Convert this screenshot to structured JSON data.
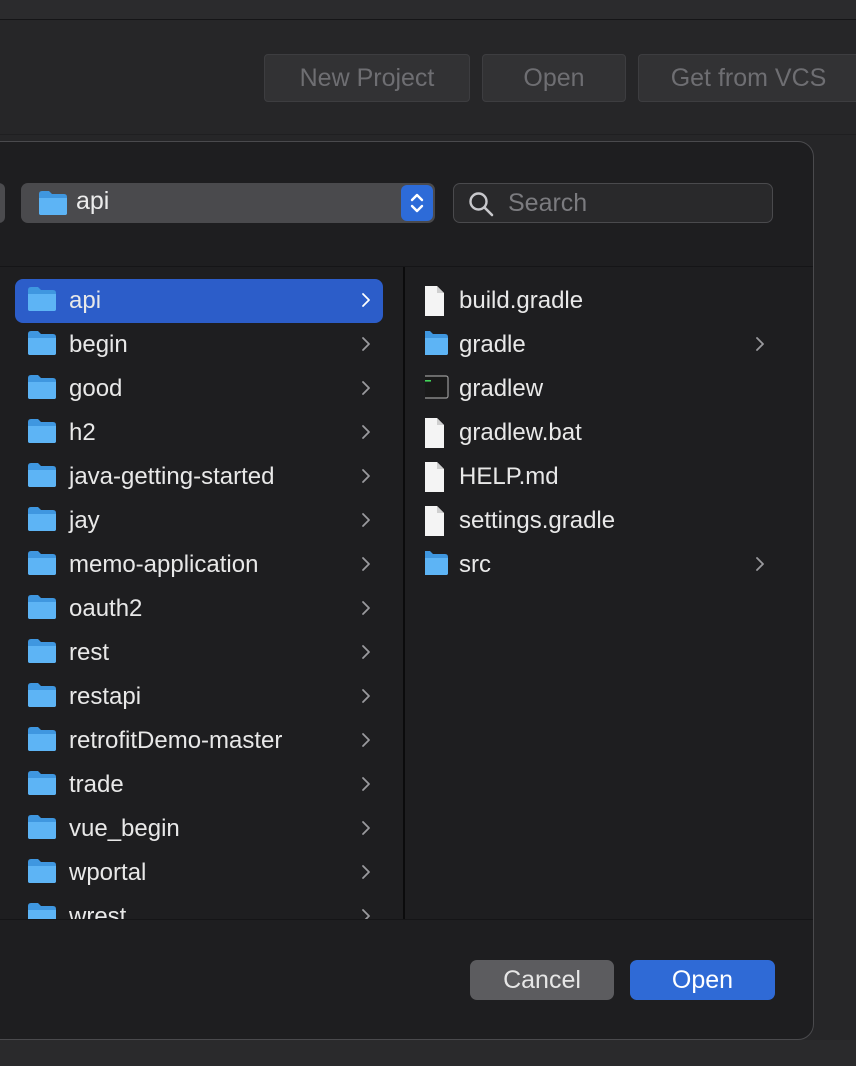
{
  "welcome": {
    "buttons": [
      "New Project",
      "Open",
      "Get from VCS"
    ]
  },
  "dialog": {
    "path_label": "api",
    "search_placeholder": "Search",
    "left_column": [
      {
        "label": "api",
        "kind": "folder",
        "selected": true
      },
      {
        "label": "begin",
        "kind": "folder"
      },
      {
        "label": "good",
        "kind": "folder"
      },
      {
        "label": "h2",
        "kind": "folder"
      },
      {
        "label": "java-getting-started",
        "kind": "folder"
      },
      {
        "label": "jay",
        "kind": "folder"
      },
      {
        "label": "memo-application",
        "kind": "folder"
      },
      {
        "label": "oauth2",
        "kind": "folder"
      },
      {
        "label": "rest",
        "kind": "folder"
      },
      {
        "label": "restapi",
        "kind": "folder"
      },
      {
        "label": "retrofitDemo-master",
        "kind": "folder"
      },
      {
        "label": "trade",
        "kind": "folder"
      },
      {
        "label": "vue_begin",
        "kind": "folder"
      },
      {
        "label": "wportal",
        "kind": "folder"
      },
      {
        "label": "wrest",
        "kind": "folder"
      }
    ],
    "right_column": [
      {
        "label": "build.gradle",
        "kind": "file"
      },
      {
        "label": "gradle",
        "kind": "folder"
      },
      {
        "label": "gradlew",
        "kind": "exec"
      },
      {
        "label": "gradlew.bat",
        "kind": "file"
      },
      {
        "label": "HELP.md",
        "kind": "file"
      },
      {
        "label": "settings.gradle",
        "kind": "file"
      },
      {
        "label": "src",
        "kind": "folder"
      }
    ],
    "cancel_label": "Cancel",
    "open_label": "Open"
  },
  "icons": {
    "folder": "folder-icon",
    "file": "document-icon",
    "exec": "terminal-executable-icon",
    "chevron": "chevron-right-icon",
    "search": "search-icon",
    "stepper": "popup-stepper-icon"
  },
  "colors": {
    "accent": "#2f6ad6",
    "selection": "#2c5dc9",
    "folder": "#4aa8f0"
  }
}
